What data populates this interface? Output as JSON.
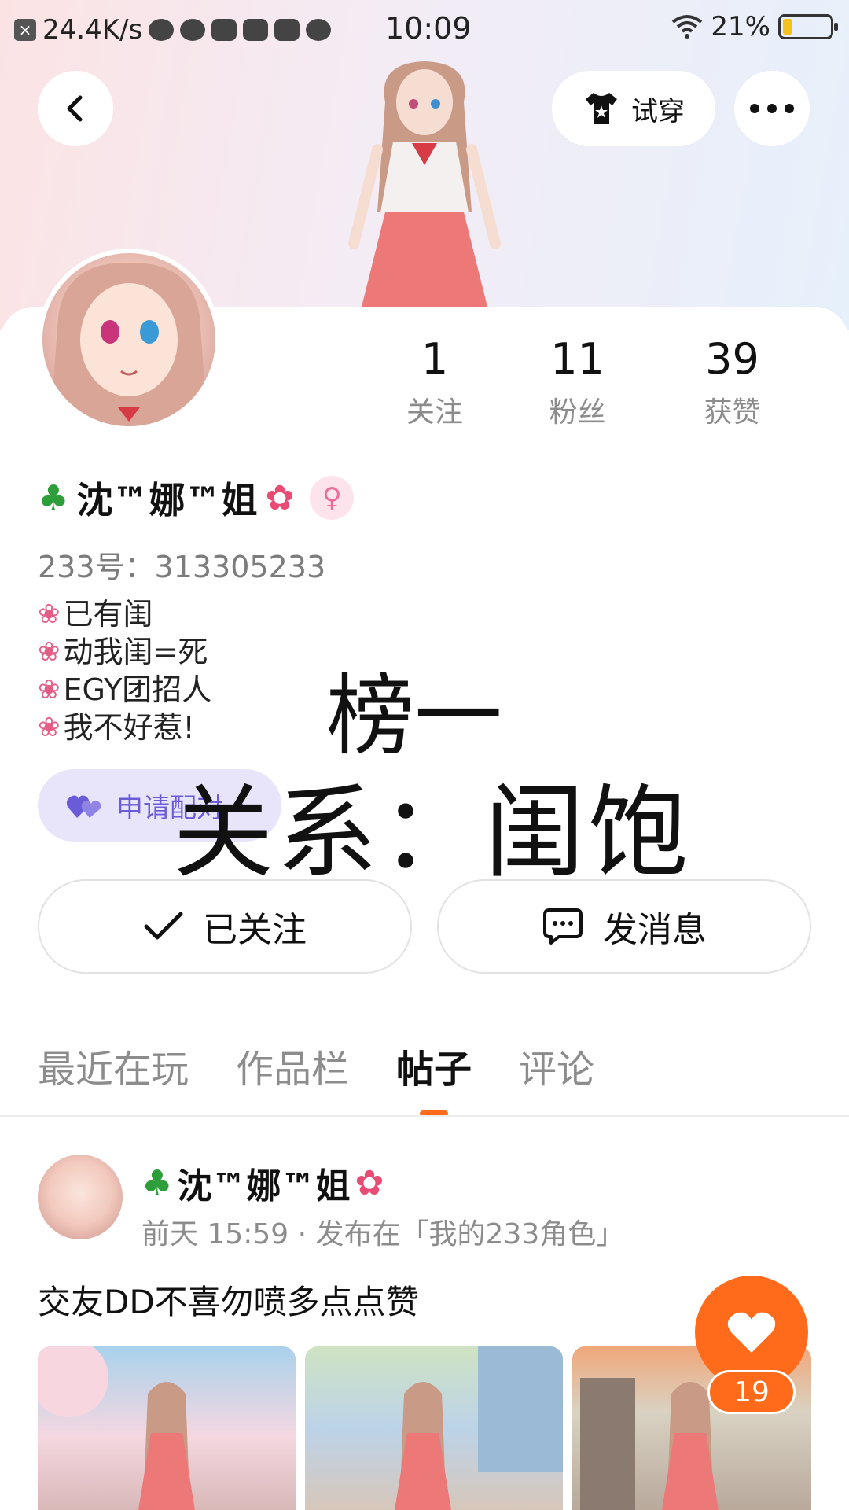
{
  "status_bar": {
    "net_speed": "24.4K/s",
    "time": "10:09",
    "battery_text": "21%",
    "battery_level": 0.21
  },
  "header": {
    "tryon_label": "试穿"
  },
  "profile": {
    "stats": [
      {
        "value": "1",
        "label": "关注"
      },
      {
        "value": "11",
        "label": "粉丝"
      },
      {
        "value": "39",
        "label": "获赞"
      }
    ],
    "name": "沈™娜™姐",
    "gender_symbol": "♀",
    "user_id": "233号：313305233",
    "bio": [
      "已有闺",
      "动我闺=死",
      "EGY团招人",
      "我不好惹!"
    ],
    "pair_label": "申请配对",
    "overlay_line1": "榜一",
    "overlay_line2": "关系：闺饱"
  },
  "actions": {
    "followed_label": "已关注",
    "message_label": "发消息"
  },
  "tabs": [
    {
      "label": "最近在玩",
      "active": false
    },
    {
      "label": "作品栏",
      "active": false
    },
    {
      "label": "帖子",
      "active": true
    },
    {
      "label": "评论",
      "active": false
    }
  ],
  "post": {
    "author": "沈™娜™姐",
    "meta": "前天 15:59 · 发布在「我的233角色」",
    "text": "交友DD不喜勿喷多点点赞",
    "like_count": "19"
  },
  "colors": {
    "accent": "#ff6b1a",
    "pair_pill_bg": "#e8e5fb",
    "pair_pill_text": "#6a5cd6"
  },
  "icons": {
    "back": "chevron-left-icon",
    "more": "more-horizontal-icon",
    "tryon": "tshirt-icon",
    "follow_check": "check-icon",
    "message": "chat-bubble-icon",
    "like": "heart-icon",
    "pair": "double-heart-icon"
  }
}
